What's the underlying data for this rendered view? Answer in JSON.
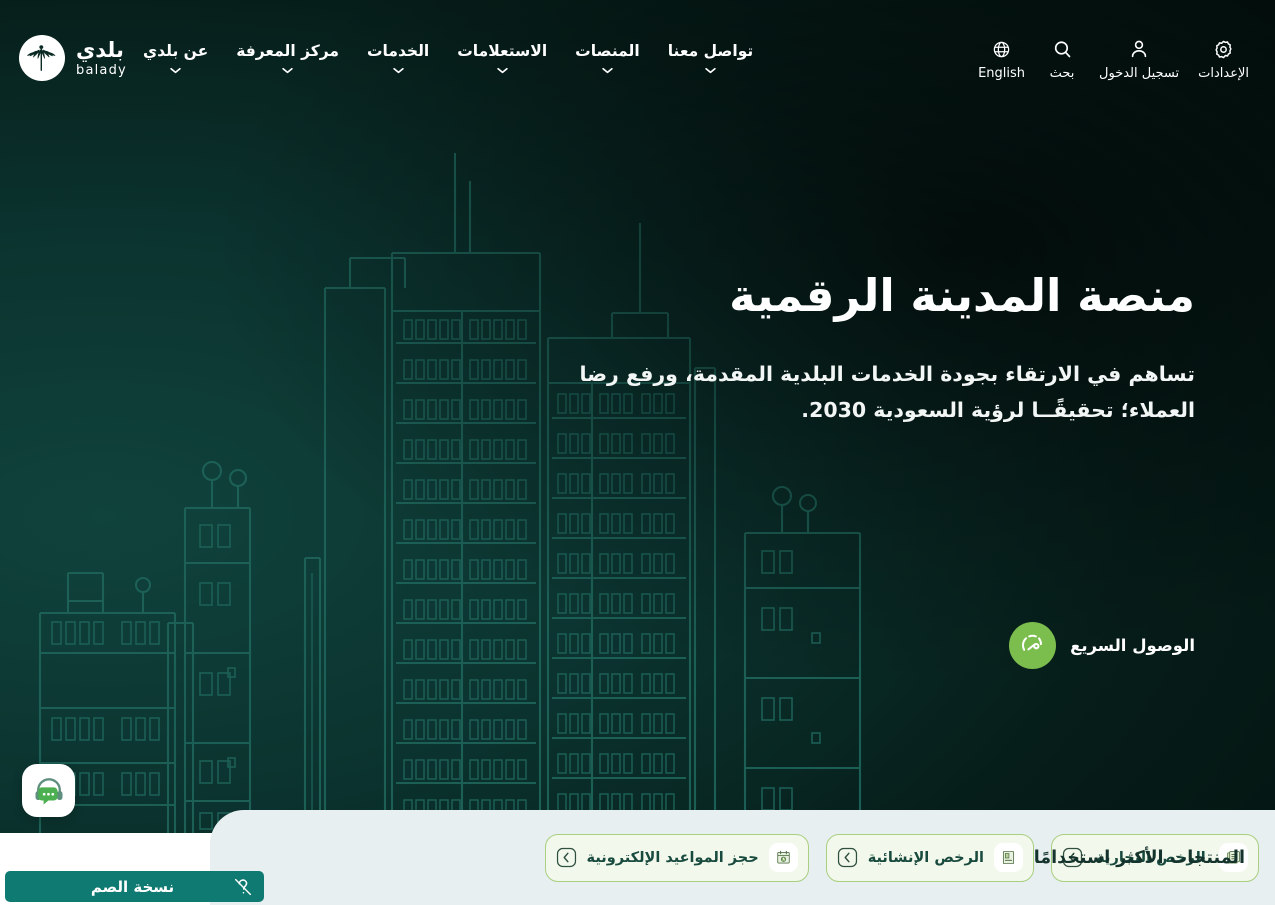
{
  "brand": {
    "name_ar": "بلدي",
    "name_en": "balady",
    "logo_icon": "palm-tree-circle-logo"
  },
  "header": {
    "main_nav": [
      {
        "label": "عن بلدي",
        "icon": "chevron-down-icon"
      },
      {
        "label": "مركز المعرفة",
        "icon": "chevron-down-icon"
      },
      {
        "label": "الخدمات",
        "icon": "chevron-down-icon"
      },
      {
        "label": "الاستعلامات",
        "icon": "chevron-down-icon"
      },
      {
        "label": "المنصات",
        "icon": "chevron-down-icon"
      },
      {
        "label": "تواصل معنا",
        "icon": "chevron-down-icon"
      }
    ],
    "util_nav": [
      {
        "label": "English",
        "icon": "globe-icon"
      },
      {
        "label": "بحث",
        "icon": "search-icon"
      },
      {
        "label": "تسجيل الدخول",
        "icon": "user-icon"
      },
      {
        "label": "الإعدادات",
        "icon": "gear-icon"
      }
    ]
  },
  "hero": {
    "title": "منصة المدينة الرقمية",
    "subtitle": "تساهم في الارتقاء بجودة الخدمات البلدية المقدمة، ورفع رضا العملاء؛ تحقيقًــا لرؤية السعودية 2030.",
    "quick_access": {
      "label": "الوصول السريع",
      "icon": "speedometer-icon",
      "color": "#7cbe4e"
    }
  },
  "products_panel": {
    "title": "المنتجات الأكثر استخدامًا",
    "cards": [
      {
        "label": "الرخص التجارية",
        "icon": "commercial-license-icon",
        "arrow": "chevron-left-icon"
      },
      {
        "label": "الرخص الإنشائية",
        "icon": "construction-license-icon",
        "arrow": "chevron-left-icon"
      },
      {
        "label": "حجز المواعيد الإلكترونية",
        "icon": "calendar-appointment-icon",
        "arrow": "chevron-left-icon"
      }
    ]
  },
  "widgets": {
    "support": {
      "icon": "headset-chat-icon"
    },
    "deaf_version": {
      "label": "نسخة الصم",
      "icon": "deaf-ear-icon",
      "color": "#0e7a72"
    }
  },
  "colors": {
    "bg_dark": "#041512",
    "bg_teal": "#0d3a35",
    "accent_green": "#7cbe4e",
    "panel_bg": "#e7eff0",
    "card_bg": "#f3f8ec",
    "card_border": "#a9cf80",
    "text_dark_green": "#14332c",
    "teal_bar": "#0e7a72"
  }
}
